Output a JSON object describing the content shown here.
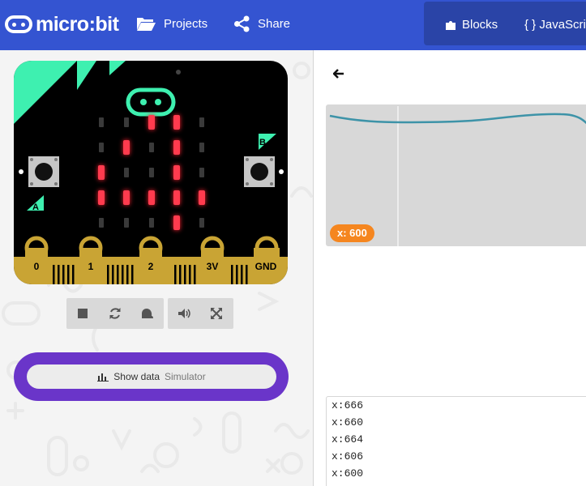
{
  "header": {
    "logo_text": "micro:bit",
    "projects_label": "Projects",
    "share_label": "Share",
    "blocks_label": "Blocks",
    "javascript_label": "{ } JavaScript",
    "bar_color": "#3454d1"
  },
  "simulator": {
    "button_a": "A",
    "button_b": "B",
    "pins": [
      "0",
      "1",
      "2",
      "3V",
      "GND"
    ],
    "led_matrix": [
      [
        0,
        0,
        1,
        1,
        0
      ],
      [
        0,
        1,
        0,
        1,
        0
      ],
      [
        1,
        0,
        0,
        1,
        0
      ],
      [
        1,
        1,
        1,
        1,
        1
      ],
      [
        0,
        0,
        0,
        1,
        0
      ]
    ],
    "controls": [
      "stop-icon",
      "restart-icon",
      "slow-mo-icon",
      "mute-icon",
      "fullscreen-icon"
    ]
  },
  "show_data": {
    "label": "Show data",
    "source": "Simulator"
  },
  "data_view": {
    "x_badge": "x: 600",
    "console_lines": [
      "x:666",
      "x:660",
      "x:664",
      "x:606",
      "x:600"
    ]
  }
}
